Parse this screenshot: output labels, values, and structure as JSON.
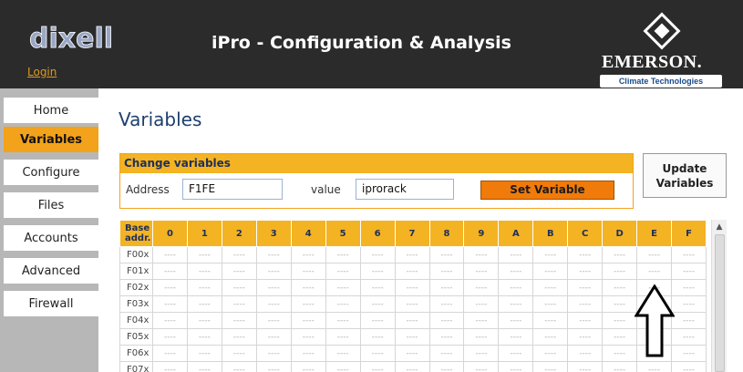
{
  "header": {
    "logo_text": "dixell",
    "login": "Login",
    "title": "iPro - Configuration & Analysis",
    "brand": "EMERSON.",
    "brand_sub": "Climate Technologies"
  },
  "sidebar": {
    "items": [
      {
        "label": "Home",
        "active": false
      },
      {
        "label": "Variables",
        "active": true
      },
      {
        "label": "Configure",
        "active": false
      },
      {
        "label": "Files",
        "active": false
      },
      {
        "label": "Accounts",
        "active": false
      },
      {
        "label": "Advanced",
        "active": false
      },
      {
        "label": "Firewall",
        "active": false
      }
    ]
  },
  "main": {
    "title": "Variables",
    "change": {
      "header": "Change variables",
      "address_label": "Address",
      "address_value": "F1FE",
      "value_label": "value",
      "value_value": "iprorack",
      "set_button": "Set Variable"
    },
    "update_button": "Update Variables",
    "table": {
      "base_header": "Base addr.",
      "columns": [
        "0",
        "1",
        "2",
        "3",
        "4",
        "5",
        "6",
        "7",
        "8",
        "9",
        "A",
        "B",
        "C",
        "D",
        "E",
        "F"
      ],
      "rows": [
        "F00x",
        "F01x",
        "F02x",
        "F03x",
        "F04x",
        "F05x",
        "F06x",
        "F07x"
      ],
      "empty_cell": "----"
    }
  },
  "colors": {
    "accent": "#f3a21b",
    "header_bg": "#2b2b2b",
    "button_orange": "#f07b0a"
  }
}
